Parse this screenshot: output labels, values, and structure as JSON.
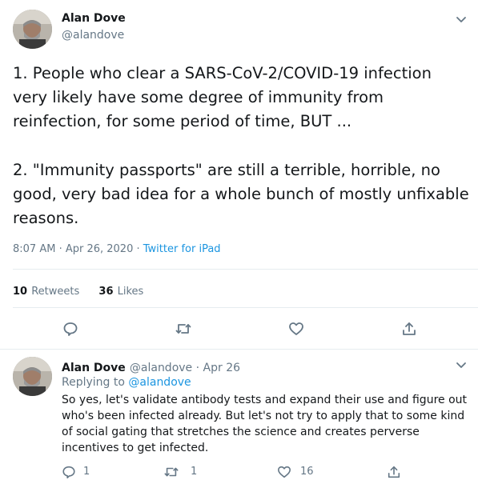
{
  "main_tweet": {
    "author_name": "Alan Dove",
    "author_handle": "@alandove",
    "paragraph1": "1. People who clear a SARS-CoV-2/COVID-19 infection very likely have some degree of immunity from reinfection, for some period of time, BUT ...",
    "paragraph2": "2. \"Immunity passports\" are still a terrible, horrible, no good, very bad idea for a whole bunch of mostly unfixable reasons.",
    "timestamp": "8:07 AM · Apr 26, 2020",
    "meta_sep": " · ",
    "source": "Twitter for iPad",
    "retweets_count": "10",
    "retweets_label": "Retweets",
    "likes_count": "36",
    "likes_label": "Likes"
  },
  "reply_tweet": {
    "author_name": "Alan Dove",
    "author_handle": "@alandove",
    "date": " · Apr 26",
    "replying_prefix": "Replying to ",
    "replying_to": "@alandove",
    "text": "So yes, let's validate antibody tests and expand their use and figure out who's been infected already. But let's not try to apply that to some kind of social gating that stretches the science and creates perverse incentives to get infected.",
    "reply_count": "1",
    "retweet_count": "1",
    "like_count": "16"
  },
  "icons": {
    "more": "chevron-down-icon",
    "reply": "reply-icon",
    "retweet": "retweet-icon",
    "like": "heart-icon",
    "share": "share-icon"
  }
}
